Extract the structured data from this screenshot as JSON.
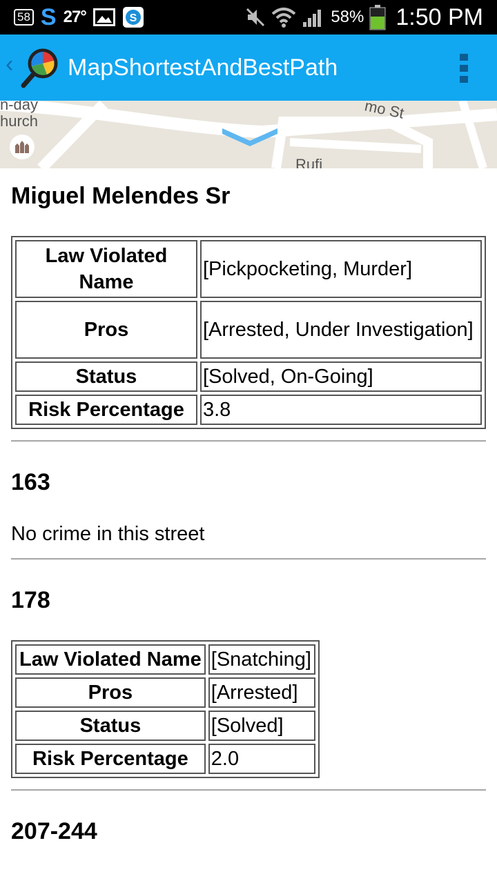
{
  "status_bar": {
    "badge": "58",
    "temperature": "27°",
    "battery_percent": "58%",
    "time": "1:50 PM",
    "icons": [
      "notification-badge-icon",
      "s-app-icon",
      "image-icon",
      "skype-icon",
      "mute-icon",
      "wifi-icon",
      "signal-icon",
      "battery-icon"
    ]
  },
  "action_bar": {
    "title": "MapShortestAndBestPath",
    "back_icon": "chevron-left-icon",
    "logo_icon": "map-magnifier-logo-icon",
    "menu_icon": "overflow-menu-icon"
  },
  "map": {
    "label_church_line1": "n-day",
    "label_church_line2": "hurch",
    "label_street": "mo St",
    "label_street2": "Rufi"
  },
  "entries": [
    {
      "title": "Miguel Melendes Sr",
      "table": [
        {
          "label": "Law Violated Name",
          "value": "[Pickpocketing, Murder]"
        },
        {
          "label": "Pros",
          "value": "[Arrested, Under Investigation]"
        },
        {
          "label": "Status",
          "value": "[Solved, On-Going]"
        },
        {
          "label": "Risk Percentage",
          "value": "3.8"
        }
      ]
    },
    {
      "title": "163",
      "text": "No crime in this street"
    },
    {
      "title": "178",
      "table": [
        {
          "label": "Law Violated Name",
          "value": "[Snatching]"
        },
        {
          "label": "Pros",
          "value": "[Arrested]"
        },
        {
          "label": "Status",
          "value": "[Solved]"
        },
        {
          "label": "Risk Percentage",
          "value": "2.0"
        }
      ]
    },
    {
      "title": "207-244"
    }
  ],
  "colors": {
    "action_bar": "#12a7f1",
    "status_bar": "#000000",
    "map_background": "#e9e5dc"
  }
}
